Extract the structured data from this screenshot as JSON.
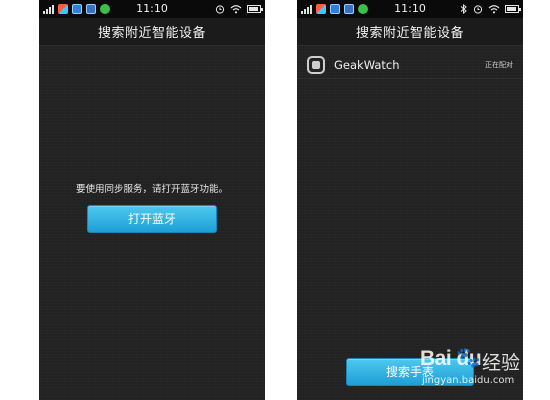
{
  "status_bar": {
    "time": "11:10",
    "battery_level": 0.9
  },
  "left_screen": {
    "title": "搜索附近智能设备",
    "message": "要使用同步服务，请打开蓝牙功能。",
    "open_bluetooth_button": "打开蓝牙"
  },
  "right_screen": {
    "title": "搜索附近智能设备",
    "device": {
      "name": "GeakWatch",
      "status": "正在配对"
    },
    "search_button": "搜索手表"
  },
  "watermark": {
    "logo": "Bai du",
    "cn": "经验",
    "url": "jingyan.baidu.com"
  },
  "colors": {
    "button_blue": "#1d9fd6",
    "background": "#232323"
  }
}
